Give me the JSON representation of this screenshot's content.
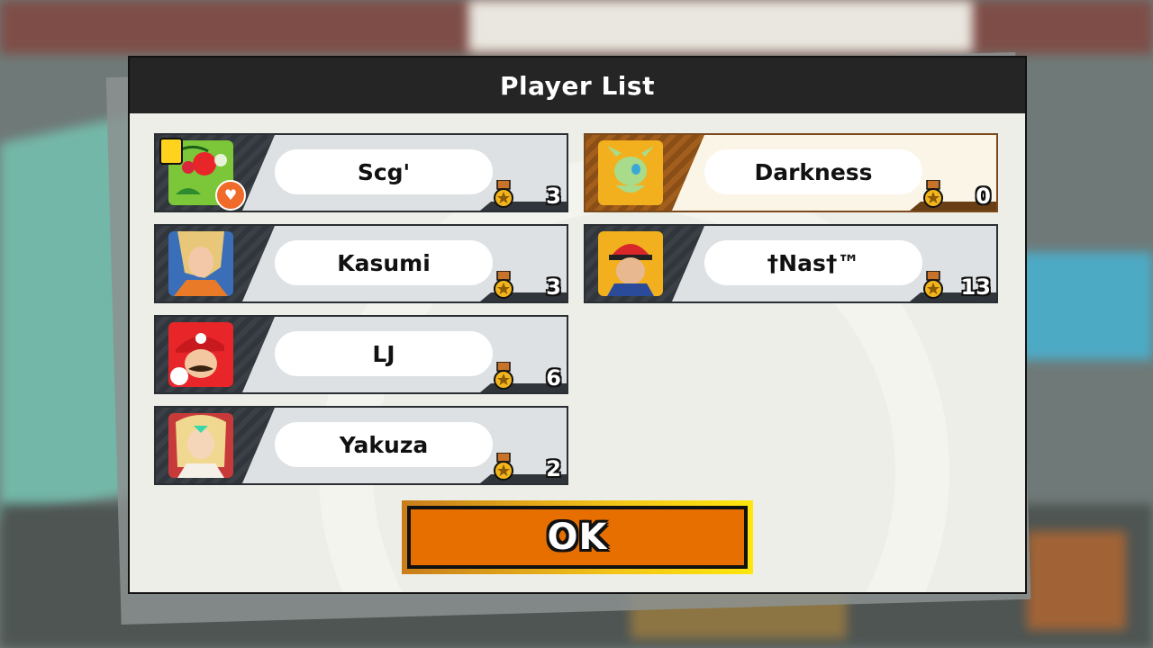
{
  "dialog": {
    "title": "Player List",
    "ok_label": "OK"
  },
  "players": [
    {
      "name": "Scg'",
      "wins": "3",
      "fighter_icon": "pac-man-icon",
      "badges": [
        "lock-icon",
        "heart-icon"
      ]
    },
    {
      "name": "Darkness",
      "wins": "0",
      "fighter_icon": "celebi-icon",
      "highlighted": true
    },
    {
      "name": "Kasumi",
      "wins": "3",
      "fighter_icon": "zero-suit-samus-icon"
    },
    {
      "name": "†Nas†™",
      "wins": "13",
      "fighter_icon": "pokemon-trainer-icon"
    },
    {
      "name": "LJ",
      "wins": "6",
      "fighter_icon": "mario-icon"
    },
    {
      "name": "Yakuza",
      "wins": "2",
      "fighter_icon": "mythra-icon"
    }
  ],
  "colors": {
    "header": "#252525",
    "card_dark": "#2f353a",
    "card_light": "#dde1e4",
    "highlight_dark": "#6a3e14",
    "highlight_light": "#fbf5e8",
    "ok_fill": "#e76f00",
    "ok_border": "#ffe60c"
  },
  "icons": {
    "wins": "medal-icon"
  }
}
